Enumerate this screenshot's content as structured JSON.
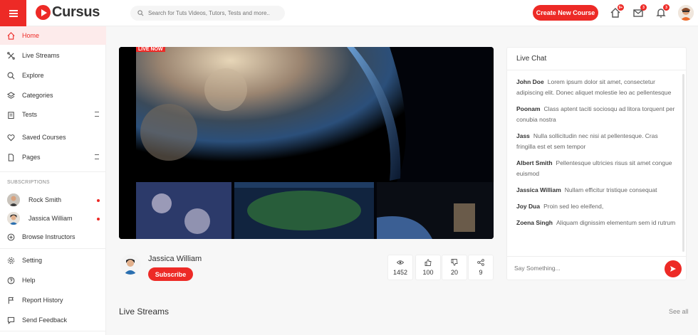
{
  "header": {
    "logo_text": "Cursus",
    "search_placeholder": "Search for Tuts Videos, Tutors, Tests and more..",
    "create_button": "Create New Course",
    "cart_badge": "9+",
    "messages_badge": "3",
    "notifications_badge": "3"
  },
  "sidebar": {
    "items": [
      {
        "label": "Home",
        "icon": "home-icon"
      },
      {
        "label": "Live Streams",
        "icon": "live-streams-icon"
      },
      {
        "label": "Explore",
        "icon": "search-icon"
      },
      {
        "label": "Categories",
        "icon": "layers-icon"
      },
      {
        "label": "Tests",
        "icon": "clipboard-icon"
      },
      {
        "label": "Saved Courses",
        "icon": "heart-icon"
      },
      {
        "label": "Pages",
        "icon": "file-icon"
      }
    ],
    "subscriptions_label": "SUBSCRIPTIONS",
    "subscriptions": [
      {
        "name": "Rock Smith",
        "live": true
      },
      {
        "name": "Jassica William",
        "live": true
      }
    ],
    "browse_instructors": "Browse Instructors",
    "bottom_items": [
      {
        "label": "Setting",
        "icon": "gear-icon"
      },
      {
        "label": "Help",
        "icon": "help-icon"
      },
      {
        "label": "Report History",
        "icon": "flag-icon"
      },
      {
        "label": "Send Feedback",
        "icon": "feedback-icon"
      }
    ]
  },
  "video": {
    "live_tag": "LIVE NOW"
  },
  "streamer": {
    "name": "Jassica William",
    "subscribe_label": "Subscribe"
  },
  "stats": {
    "views": "1452",
    "likes": "100",
    "dislikes": "20",
    "shares": "9"
  },
  "section": {
    "title": "Live Streams",
    "see_all": "See all"
  },
  "chat": {
    "title": "Live Chat",
    "messages": [
      {
        "user": "John Doe",
        "text": "Lorem ipsum dolor sit amet, consectetur adipiscing elit. Donec aliquet molestie leo ac pellentesque"
      },
      {
        "user": "Poonam",
        "text": "Class aptent taciti sociosqu ad litora torquent per conubia nostra"
      },
      {
        "user": "Jass",
        "text": "Nulla sollicitudin nec nisi at pellentesque. Cras fringilla est et sem tempor"
      },
      {
        "user": "Albert Smith",
        "text": "Pellentesque ultricies risus sit amet congue euismod"
      },
      {
        "user": "Jassica William",
        "text": "Nullam efficitur tristique consequat"
      },
      {
        "user": "Joy Dua",
        "text": "Proin sed leo eleifend,"
      },
      {
        "user": "Zoena Singh",
        "text": "Aliquam dignissim elementum sem id rutrum"
      }
    ],
    "input_placeholder": "Say Something..."
  },
  "colors": {
    "accent": "#ed2a26",
    "active_bg": "#fdebeb"
  }
}
